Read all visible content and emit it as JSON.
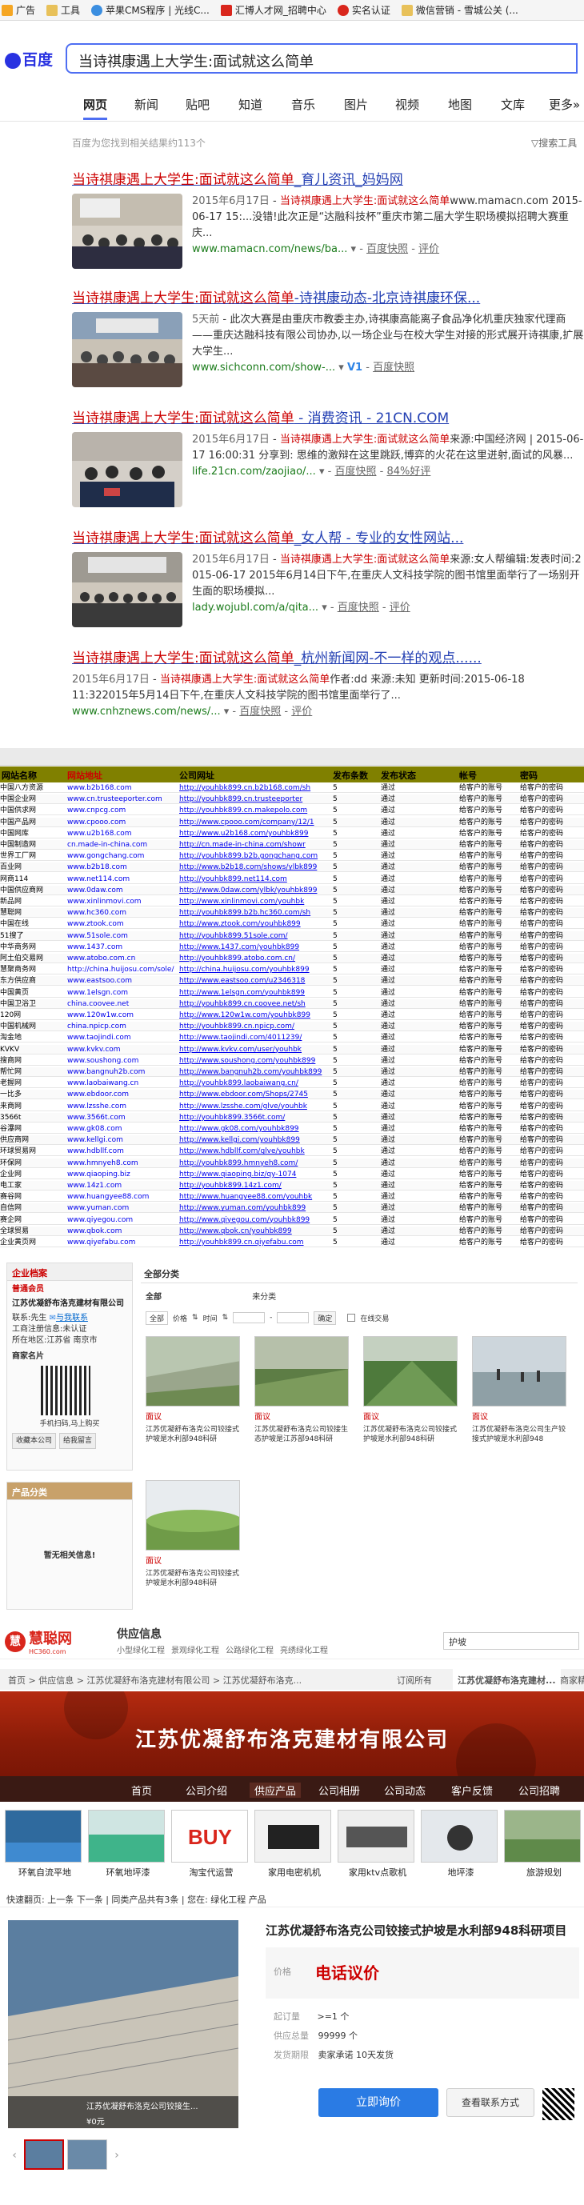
{
  "bookmarks": [
    {
      "label": "广告",
      "icon": "ad-icon"
    },
    {
      "label": "工具",
      "icon": "folder-icon"
    },
    {
      "label": "苹果CMS程序 | 光线C...",
      "icon": "apple-icon"
    },
    {
      "label": "汇博人才网_招聘中心",
      "icon": "hb-icon"
    },
    {
      "label": "实名认证",
      "icon": "paw-icon"
    },
    {
      "label": "微信营销 - 雪城公关 (...",
      "icon": "folder-icon"
    }
  ],
  "baidu": {
    "logo": "百度",
    "query": "当诗祺康遇上大学生:面试就这么简单",
    "tabs": [
      "网页",
      "新闻",
      "贴吧",
      "知道",
      "音乐",
      "图片",
      "视频",
      "地图",
      "文库",
      "更多»"
    ],
    "result_count": "百度为您找到相关结果约113个",
    "search_tools": "搜索工具",
    "results": [
      {
        "title_em": "当诗祺康遇上大学生:面试就这么简单",
        "title_rest": "_育儿资讯_妈妈网",
        "date": "2015年6月17日",
        "text_em": "当诗祺康遇上大学生:面试就这么简单",
        "text": "www.mamacn.com 2015-06-17 15:...没错!此次正是“达融科技杯”重庆市第二届大学生职场模拟招聘大赛重庆...",
        "url": "www.mamacn.com/news/ba...",
        "snapshot": "百度快照",
        "rating": "评价"
      },
      {
        "title_em": "当诗祺康遇上大学生:面试就这么简单",
        "title_rest": "-诗祺康动态-北京诗祺康环保...",
        "date": "5天前",
        "text": "此次大赛是由重庆市教委主办,诗祺康高能离子食品净化机重庆独家代理商——重庆达融科技有限公司协办,以一场企业与在校大学生对接的形式展开诗祺康,扩展大学生...",
        "url": "www.sichconn.com/show-...",
        "v_badge": "V1",
        "snapshot": "百度快照",
        "rating": ""
      },
      {
        "title_em": "当诗祺康遇上大学生:面试就这么简单",
        "title_rest": " - 消费资讯 - 21CN.COM",
        "date": "2015年6月17日",
        "text_em": "当诗祺康遇上大学生:面试就这么简单",
        "text": "来源:中国经济网 | 2015-06-17 16:00:31 分享到: 思维的激辩在这里跳跃,博弈的火花在这里迸射,面试的风暴...",
        "url": "life.21cn.com/zaojiao/...",
        "snapshot": "百度快照",
        "rating": "84%好评"
      },
      {
        "title_em": "当诗祺康遇上大学生:面试就这么简单",
        "title_rest": "_女人帮 - 专业的女性网站...",
        "date": "2015年6月17日",
        "text_em": "当诗祺康遇上大学生:面试就这么简单",
        "text": "来源:女人帮编辑:发表时间:2015-06-17 2015年6月14日下午,在重庆人文科技学院的图书馆里面举行了一场别开生面的职场模拟...",
        "url": "lady.wojubl.com/a/qita...",
        "snapshot": "百度快照",
        "rating": "评价"
      },
      {
        "title_em": "当诗祺康遇上大学生:面试就这么简单",
        "title_rest": "_杭州新闻网-不一样的观点......",
        "date": "2015年6月17日",
        "text_em": "当诗祺康遇上大学生:面试就这么简单",
        "text": "作者:dd 来源:未知 更新时间:2015-06-18 11:322015年5月14日下午,在重庆人文科技学院的图书馆里面举行了...",
        "url": "www.cnhznews.com/news/...",
        "snapshot": "百度快照",
        "rating": "评价"
      }
    ]
  },
  "sheet": {
    "headers": [
      "网站名称",
      "网站地址",
      "公司网址",
      "发布条数",
      "发布状态",
      "帐号",
      "密码"
    ],
    "rows": [
      [
        "中国八方资源",
        "www.b2b168.com",
        "http://youhbk899.cn.b2b168.com/sh",
        "5",
        "通过",
        "给客户的账号",
        "给客户的密码"
      ],
      [
        "中国企业网",
        "www.cn.trusteeporter.com",
        "http://youhbk899.cn.trusteeporter",
        "5",
        "通过",
        "给客户的账号",
        "给客户的密码"
      ],
      [
        "中国供求网",
        "www.cnpcg.com",
        "http://youhbk899.cn.makepolo.com",
        "5",
        "通过",
        "给客户的账号",
        "给客户的密码"
      ],
      [
        "中国产品网",
        "www.cpooo.com",
        "http://www.cpooo.com/company/12/1",
        "5",
        "通过",
        "给客户的账号",
        "给客户的密码"
      ],
      [
        "中国网库",
        "www.u2b168.com",
        "http://www.u2b168.com/youhbk899",
        "5",
        "通过",
        "给客户的账号",
        "给客户的密码"
      ],
      [
        "中国制造网",
        "cn.made-in-china.com",
        "http://cn.made-in-china.com/showr",
        "5",
        "通过",
        "给客户的账号",
        "给客户的密码"
      ],
      [
        "世界工厂网",
        "www.gongchang.com",
        "http://youhbk899.b2b.gongchang.com",
        "5",
        "通过",
        "给客户的账号",
        "给客户的密码"
      ],
      [
        "百业网",
        "www.b2b18.com",
        "http://www.b2b18.com/shows/ylbk899",
        "5",
        "通过",
        "给客户的账号",
        "给客户的密码"
      ],
      [
        "网商114",
        "www.net114.com",
        "http://youhbk899.net114.com",
        "5",
        "通过",
        "给客户的账号",
        "给客户的密码"
      ],
      [
        "中国供应商网",
        "www.0daw.com",
        "http://www.0daw.com/ylbk/youhbk899",
        "5",
        "通过",
        "给客户的账号",
        "给客户的密码"
      ],
      [
        "新品网",
        "www.xinlinmovi.com",
        "http://www.xinlinmovi.com/youhbk",
        "5",
        "通过",
        "给客户的账号",
        "给客户的密码"
      ],
      [
        "慧聪网",
        "www.hc360.com",
        "http://youhbk899.b2b.hc360.com/sh",
        "5",
        "通过",
        "给客户的账号",
        "给客户的密码"
      ],
      [
        "中国在线",
        "www.ztook.com",
        "http://www.ztook.com/youhbk899",
        "5",
        "通过",
        "给客户的账号",
        "给客户的密码"
      ],
      [
        "51搜了",
        "www.51sole.com",
        "http://youhbk899.51sole.com/",
        "5",
        "通过",
        "给客户的账号",
        "给客户的密码"
      ],
      [
        "中华商务网",
        "www.1437.com",
        "http://www.1437.com/youhbk899",
        "5",
        "通过",
        "给客户的账号",
        "给客户的密码"
      ],
      [
        "阿土伯交易网",
        "www.atobo.com.cn",
        "http://youhbk899.atobo.com.cn/",
        "5",
        "通过",
        "给客户的账号",
        "给客户的密码"
      ],
      [
        "慧聚商务网",
        "http://china.huijosu.com/sole/",
        "http://china.huijosu.com/youhbk899",
        "5",
        "通过",
        "给客户的账号",
        "给客户的密码"
      ],
      [
        "东方供应商",
        "www.eastsoo.com",
        "http://www.eastsoo.com/u2346318",
        "5",
        "通过",
        "给客户的账号",
        "给客户的密码"
      ],
      [
        "中国黄页",
        "www.1elsgn.com",
        "http://www.1elsgn.com/youhbk899",
        "5",
        "通过",
        "给客户的账号",
        "给客户的密码"
      ],
      [
        "中国卫浴卫",
        "china.coovee.net",
        "http://youhbk899.cn.coovee.net/sh",
        "5",
        "通过",
        "给客户的账号",
        "给客户的密码"
      ],
      [
        "120网",
        "www.120w1w.com",
        "http://www.120w1w.com/youhbk899",
        "5",
        "通过",
        "给客户的账号",
        "给客户的密码"
      ],
      [
        "中国机械网",
        "china.npicp.com",
        "http://youhbk899.cn.npicp.com/",
        "5",
        "通过",
        "给客户的账号",
        "给客户的密码"
      ],
      [
        "淘金地",
        "www.taojindi.com",
        "http://www.taojindi.com/4011239/",
        "5",
        "通过",
        "给客户的账号",
        "给客户的密码"
      ],
      [
        "KVKV",
        "www.kvkv.com",
        "http://www.kvkv.com/user/youhbk",
        "5",
        "通过",
        "给客户的账号",
        "给客户的密码"
      ],
      [
        "搜商网",
        "www.soushong.com",
        "http://www.soushong.com/youhbk899",
        "5",
        "通过",
        "给客户的账号",
        "给客户的密码"
      ],
      [
        "帮忙网",
        "www.bangnuh2b.com",
        "http://www.bangnuh2b.com/youhbk899",
        "5",
        "通过",
        "给客户的账号",
        "给客户的密码"
      ],
      [
        "老握网",
        "www.laobaiwang.cn",
        "http://youhbk899.laobaiwang.cn/",
        "5",
        "通过",
        "给客户的账号",
        "给客户的密码"
      ],
      [
        "一比多",
        "www.ebdoor.com",
        "http://www.ebdoor.com/Shops/2745",
        "5",
        "通过",
        "给客户的账号",
        "给客户的密码"
      ],
      [
        "来商网",
        "www.lzsshe.com",
        "http://www.lzsshe.com/glve/youhbk",
        "5",
        "通过",
        "给客户的账号",
        "给客户的密码"
      ],
      [
        "3566t",
        "www.3566t.com",
        "http://youhbk899.3566t.com/",
        "5",
        "通过",
        "给客户的账号",
        "给客户的密码"
      ],
      [
        "谷瀑网",
        "www.gk08.com",
        "http://www.gk08.com/youhbk899",
        "5",
        "通过",
        "给客户的账号",
        "给客户的密码"
      ],
      [
        "供应商网",
        "www.kellgi.com",
        "http://www.kellgi.com/youhbk899",
        "5",
        "通过",
        "给客户的账号",
        "给客户的密码"
      ],
      [
        "环球贸易网",
        "www.hdbllf.com",
        "http://www.hdbllf.com/glve/youhbk",
        "5",
        "通过",
        "给客户的账号",
        "给客户的密码"
      ],
      [
        "环保网",
        "www.hmnyeh8.com",
        "http://youhbk899.hmnyeh8.com/",
        "5",
        "通过",
        "给客户的账号",
        "给客户的密码"
      ],
      [
        "企业网",
        "www.qiaoping.biz",
        "http://www.qiaoping.biz/qy-1074",
        "5",
        "通过",
        "给客户的账号",
        "给客户的密码"
      ],
      [
        "电工家",
        "www.14z1.com",
        "http://youhbk899.14z1.com/",
        "5",
        "通过",
        "给客户的账号",
        "给客户的密码"
      ],
      [
        "赛谷网",
        "www.huangyee88.com",
        "http://www.huangyee88.com/youhbk",
        "5",
        "通过",
        "给客户的账号",
        "给客户的密码"
      ],
      [
        "自信网",
        "www.yuman.com",
        "http://www.yuman.com/youhbk899",
        "5",
        "通过",
        "给客户的账号",
        "给客户的密码"
      ],
      [
        "赛企网",
        "www.qiyegou.com",
        "http://www.qiyegou.com/youhbk899",
        "5",
        "通过",
        "给客户的账号",
        "给客户的密码"
      ],
      [
        "全球贸易",
        "www.qbok.com",
        "http://www.qbok.cn/youhbk899",
        "5",
        "通过",
        "给客户的账号",
        "给客户的密码"
      ],
      [
        "企业黄页网",
        "www.qiyefabu.com",
        "http://youhbk899.cn.qiyefabu.com",
        "5",
        "通过",
        "给客户的账号",
        "给客户的密码"
      ]
    ]
  },
  "shop1": {
    "profile_title": "企业档案",
    "member_label": "普通会员",
    "company": "江苏优凝舒布洛克建材有限公司",
    "contact_label": "联系:",
    "contact_name": "先生",
    "im_label": "与我联系",
    "verify_label": "工商注册信息:",
    "verify_value": "未认证",
    "location_label": "所在地区:",
    "location_value": "江苏省 南京市",
    "shop_qr_label": "商家名片",
    "mobile_label": "手机扫码,马上购买",
    "fav_button": "收藏本公司",
    "shop_button": "给我留言",
    "category_title": "产品分类",
    "no_category": "暂无相关信息!",
    "all_category": "全部分类",
    "tab_all": "全部",
    "tab_category": "来分类",
    "filter_all": "全部",
    "filter_price": "价格",
    "filter_time": "时间",
    "filter_confirm": "确定",
    "filter_online": "在线交易",
    "products": [
      {
        "price": "面议",
        "desc": "江苏优凝舒布洛克公司铰接式护坡是水利部948科研"
      },
      {
        "price": "面议",
        "desc": "江苏优凝舒布洛克公司铰接生态护坡是江苏部948科研"
      },
      {
        "price": "面议",
        "desc": "江苏优凝舒布洛克公司铰接式护坡是水利部948科研"
      },
      {
        "price": "面议",
        "desc": "江苏优凝舒布洛克公司生产铰接式护坡是水利部948"
      },
      {
        "price": "面议",
        "desc": "江苏优凝舒布洛克公司铰接式护坡是水利部948科研"
      }
    ]
  },
  "shop2": {
    "brand": "慧聪网",
    "brand_sub": "HC360.com",
    "section": "供应信息",
    "links": [
      "小型绿化工程",
      "景观绿化工程",
      "公路绿化工程",
      "亮绣绿化工程"
    ],
    "search_placeholder": "护坡",
    "breadcrumb": "首页 > 供应信息 > 江苏优凝舒布洛克建材有限公司 > 江苏优凝舒布洛克...",
    "crumb_tabs": [
      "订阅所有",
      "江苏优凝舒布洛克建材...",
      "商家精"
    ],
    "banner_title": "江苏优凝舒布洛克建材有限公司",
    "nav": [
      "首页",
      "公司介绍",
      "供应产品",
      "公司相册",
      "公司动态",
      "客户反馈",
      "公司招聘"
    ],
    "thumbs": [
      "环氧自流平地",
      "环氧地坪漆",
      "淘宝代运营",
      "家用电密机机",
      "家用ktv点歌机",
      "地坪漆",
      "旅游规划"
    ],
    "quicknav": "快速翻页: 上一条 下一条 | 同类产品共有3条 | 您在: 绿化工程 产品",
    "product_title": "江苏优凝舒布洛克公司铰接式护坡是水利部948科研项目",
    "price_label": "价格",
    "price_value": "电话议价",
    "moq_label": "起订量",
    "moq_value": ">=1 个",
    "stock_label": "供应总量",
    "stock_value": "99999 个",
    "ship_label": "发货期限",
    "ship_value": "卖家承诺 10天发货",
    "consult_button": "立即询价",
    "contact_button": "查看联系方式",
    "img_caption": "江苏优凝舒布洛克公司铰接生...",
    "img_price": "¥0元",
    "colors": {
      "accent": "#c00",
      "banner": "#9a2010",
      "nav": "#3a1a14"
    }
  }
}
